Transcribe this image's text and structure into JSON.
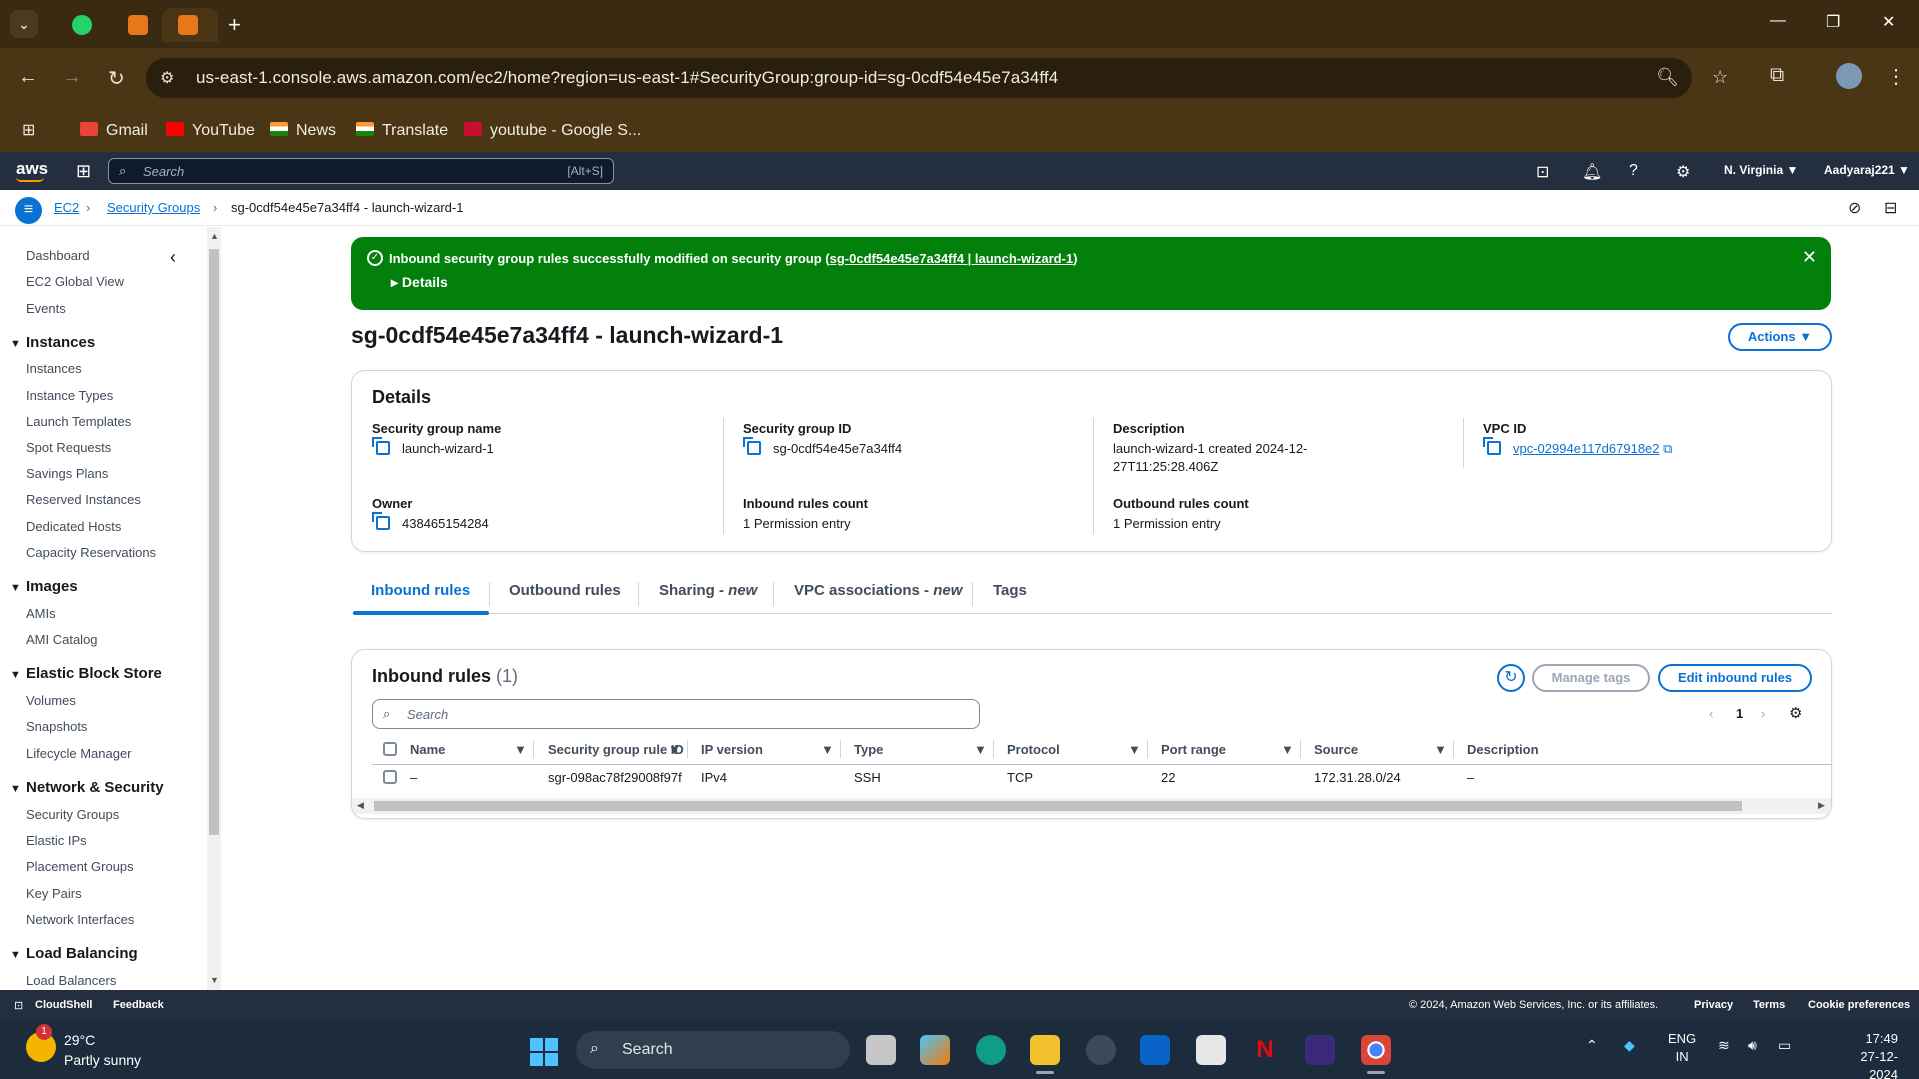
{
  "browser": {
    "tabs": [
      {
        "name": "whatsapp",
        "icon": "whatsapp-icon"
      },
      {
        "name": "aws-console",
        "icon": "aws-icon"
      },
      {
        "name": "aws-console-active",
        "icon": "aws-icon"
      }
    ],
    "new_tab_label": "+",
    "url": "us-east-1.console.aws.amazon.com/ec2/home?region=us-east-1#SecurityGroup:group-id=sg-0cdf54e45e7a34ff4",
    "bookmarks": [
      {
        "label": "Gmail",
        "color": "#ea4335"
      },
      {
        "label": "YouTube",
        "color": "#ff0000"
      },
      {
        "label": "News",
        "color": "#ff9933"
      },
      {
        "label": "Translate",
        "color": "#ff9933"
      },
      {
        "label": "youtube - Google S...",
        "color": "#c8102e"
      }
    ]
  },
  "aws_header": {
    "logo": "aws",
    "search_placeholder": "Search",
    "search_hotkey": "[Alt+S]",
    "region": "N. Virginia ▼",
    "account": "Aadyaraj221 ▼"
  },
  "breadcrumb": {
    "items": [
      "EC2",
      "Security Groups",
      "sg-0cdf54e45e7a34ff4 - launch-wizard-1"
    ],
    "separator": "›"
  },
  "sidebar": {
    "top_items": [
      "Dashboard",
      "EC2 Global View",
      "Events"
    ],
    "sections": [
      {
        "title": "Instances",
        "items": [
          "Instances",
          "Instance Types",
          "Launch Templates",
          "Spot Requests",
          "Savings Plans",
          "Reserved Instances",
          "Dedicated Hosts",
          "Capacity Reservations"
        ]
      },
      {
        "title": "Images",
        "items": [
          "AMIs",
          "AMI Catalog"
        ]
      },
      {
        "title": "Elastic Block Store",
        "items": [
          "Volumes",
          "Snapshots",
          "Lifecycle Manager"
        ]
      },
      {
        "title": "Network & Security",
        "items": [
          "Security Groups",
          "Elastic IPs",
          "Placement Groups",
          "Key Pairs",
          "Network Interfaces"
        ]
      },
      {
        "title": "Load Balancing",
        "items": [
          "Load Balancers"
        ]
      }
    ]
  },
  "flash": {
    "message": "Inbound security group rules successfully modified on security group (",
    "link": "sg-0cdf54e45e7a34ff4 | launch-wizard-1",
    "message_end": ")",
    "details_label": "Details"
  },
  "page": {
    "title": "sg-0cdf54e45e7a34ff4 - launch-wizard-1",
    "actions_label": "Actions ▼"
  },
  "details": {
    "title": "Details",
    "security_group_name": {
      "label": "Security group name",
      "value": "launch-wizard-1"
    },
    "security_group_id": {
      "label": "Security group ID",
      "value": "sg-0cdf54e45e7a34ff4"
    },
    "description": {
      "label": "Description",
      "value_line1": "launch-wizard-1 created 2024-12-",
      "value_line2": "27T11:25:28.406Z"
    },
    "vpc_id": {
      "label": "VPC ID",
      "value": "vpc-02994e117d67918e2"
    },
    "owner": {
      "label": "Owner",
      "value": "438465154284"
    },
    "inbound_rules_count": {
      "label": "Inbound rules count",
      "value": "1 Permission entry"
    },
    "outbound_rules_count": {
      "label": "Outbound rules count",
      "value": "1 Permission entry"
    }
  },
  "tabs": [
    {
      "label": "Inbound rules",
      "suffix": ""
    },
    {
      "label": "Outbound rules",
      "suffix": ""
    },
    {
      "label": "Sharing - ",
      "suffix": "new"
    },
    {
      "label": "VPC associations - ",
      "suffix": "new"
    },
    {
      "label": "Tags",
      "suffix": ""
    }
  ],
  "inbound_rules": {
    "title": "Inbound rules",
    "count": "(1)",
    "manage_tags_label": "Manage tags",
    "edit_label": "Edit inbound rules",
    "search_placeholder": "Search",
    "page": "1",
    "columns": [
      "Name",
      "Security group rule ID",
      "IP version",
      "Type",
      "Protocol",
      "Port range",
      "Source",
      "Description"
    ],
    "rows": [
      [
        "–",
        "sgr-098ac78f29008f97f",
        "IPv4",
        "SSH",
        "TCP",
        "22",
        "172.31.28.0/24",
        "–"
      ]
    ]
  },
  "footer": {
    "cloudshell": "CloudShell",
    "feedback": "Feedback",
    "copyright": "© 2024, Amazon Web Services, Inc. or its affiliates.",
    "privacy": "Privacy",
    "terms": "Terms",
    "cookies": "Cookie preferences"
  },
  "taskbar": {
    "temperature": "29°C",
    "weather": "Partly sunny",
    "weather_badge": "1",
    "search_placeholder": "Search",
    "lang_line1": "ENG",
    "lang_line2": "IN",
    "time": "17:49",
    "date": "27-12-2024"
  }
}
